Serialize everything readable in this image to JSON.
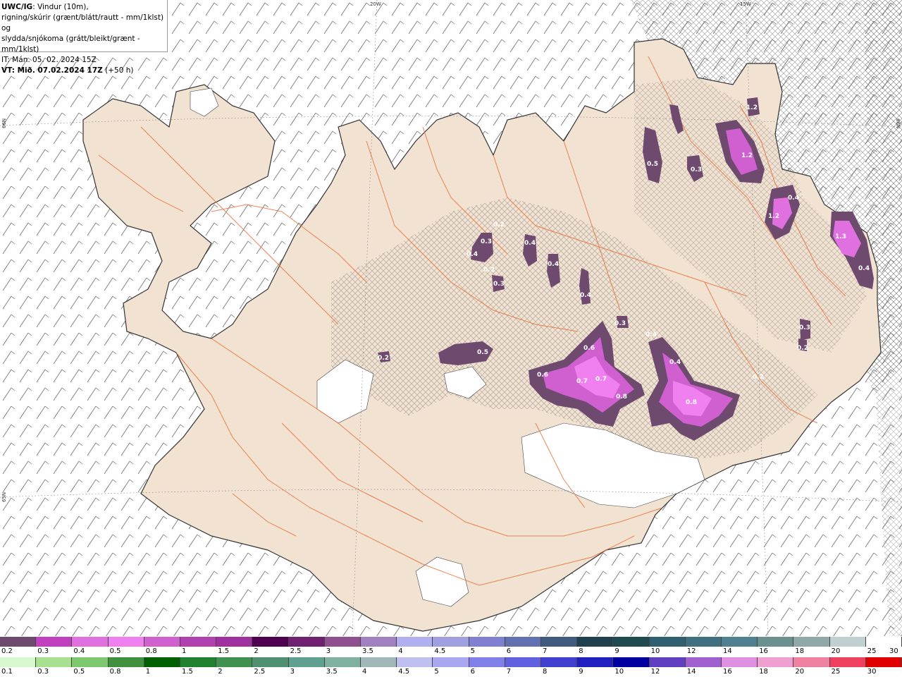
{
  "info": {
    "line1_bold": "UWC/IG",
    "line1_rest": ": Vindur (10m),",
    "line2": "rigning/skúrir (grænt/blátt/rautt - mm/1klst) og",
    "line3": "slydda/snjókoma (grátt/bleikt/grænt - mm/1klst)",
    "line4": "IT: Mán. 05. 02. 2024 15Z",
    "line5_bold": "VT: Mið. 07.02.2024 17Z",
    "line5_rest": " (+50 h)"
  },
  "grid_labels": {
    "top_20w": "20W",
    "top_15w": "15W",
    "left_66n": "66N",
    "right_66n": "66N",
    "left_65n": "65N"
  },
  "map_values": [
    {
      "label": "1.2"
    },
    {
      "label": "1.2"
    },
    {
      "label": "0.5"
    },
    {
      "label": "0.3"
    },
    {
      "label": "0.4"
    },
    {
      "label": "1.2"
    },
    {
      "label": "1.3"
    },
    {
      "label": "0.4"
    },
    {
      "label": "0.2"
    },
    {
      "label": "0.3"
    },
    {
      "label": "0.4"
    },
    {
      "label": "0.2"
    },
    {
      "label": "0.4"
    },
    {
      "label": "0.4"
    },
    {
      "label": "0.3"
    },
    {
      "label": "0.4"
    },
    {
      "label": "0.3"
    },
    {
      "label": "0.4"
    },
    {
      "label": "0.5"
    },
    {
      "label": "0.6"
    },
    {
      "label": "0.6"
    },
    {
      "label": "0.7"
    },
    {
      "label": "0.7"
    },
    {
      "label": "0.8"
    },
    {
      "label": "0.4"
    },
    {
      "label": "0.8"
    },
    {
      "label": "0.2"
    },
    {
      "label": "0.4"
    },
    {
      "label": "0.2"
    },
    {
      "label": "0.2"
    },
    {
      "label": "0.3"
    },
    {
      "label": "0.2"
    }
  ],
  "legend_snow": {
    "labels": [
      "0.2",
      "0.3",
      "0.4",
      "0.5",
      "0.8",
      "1",
      "1.5",
      "2",
      "2.5",
      "3",
      "3.5",
      "4",
      "4.5",
      "5",
      "6",
      "7",
      "8",
      "9",
      "10",
      "12",
      "14",
      "16",
      "18",
      "20",
      "25",
      "30"
    ],
    "colors": [
      "#6e4a6e",
      "#c040c0",
      "#e070e0",
      "#f080f0",
      "#d060d0",
      "#b040b0",
      "#a030a0",
      "#500050",
      "#702070",
      "#905090",
      "#a080c0",
      "#b0b0f0",
      "#a0a0e0",
      "#8080d0",
      "#6070b0",
      "#405a80",
      "#204050",
      "#1e4a50",
      "#306070",
      "#407080",
      "#508090",
      "#6a9090",
      "#90a8a8",
      "#c0d0d0",
      "#ffffff"
    ]
  },
  "legend_rain": {
    "labels": [
      "0.1",
      "0.3",
      "0.5",
      "0.8",
      "1",
      "1.5",
      "2",
      "2.5",
      "3",
      "3.5",
      "4",
      "4.5",
      "5",
      "6",
      "7",
      "8",
      "9",
      "10",
      "12",
      "14",
      "16",
      "18",
      "20",
      "25",
      "30"
    ],
    "colors": [
      "#d8f8d0",
      "#a8e090",
      "#80c870",
      "#409040",
      "#006000",
      "#208030",
      "#409050",
      "#509070",
      "#60a090",
      "#80b0a0",
      "#a0b8b8",
      "#c0c0f0",
      "#a8a8f0",
      "#8080e8",
      "#6060e0",
      "#4040d0",
      "#2020c0",
      "#0000a0",
      "#6040c0",
      "#a060d0",
      "#e090e0",
      "#f0a0d0",
      "#f080a0",
      "#f04060",
      "#e00000"
    ]
  }
}
